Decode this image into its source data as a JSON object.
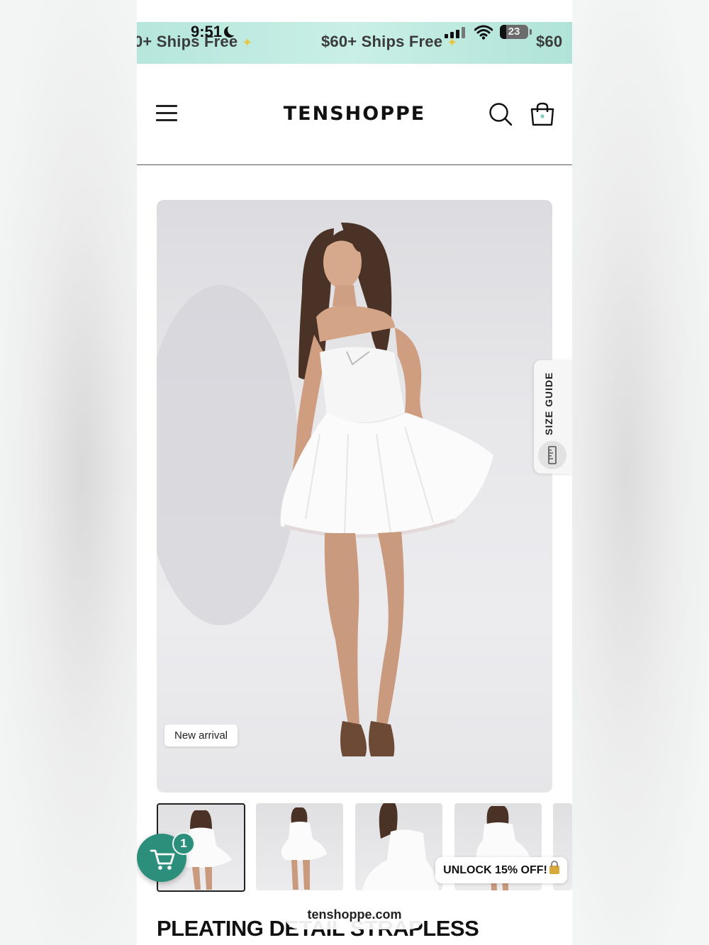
{
  "status_bar": {
    "time": "9:51",
    "battery": "23"
  },
  "promo_banner": {
    "text_left": "0+ Ships Free",
    "text_center": "$60+ Ships Free",
    "text_right": "$60"
  },
  "header": {
    "logo": "TENSHOPPE"
  },
  "product": {
    "badge": "New arrival",
    "size_guide_label": "SIZE GUIDE",
    "title": "PLEATING DETAIL STRAPLESS"
  },
  "cart": {
    "count": "1"
  },
  "promo_popup": {
    "label": "UNLOCK 15% OFF!"
  },
  "browser": {
    "url": "tenshoppe.com"
  },
  "colors": {
    "banner": "#b6e6dc",
    "cart_fab": "#2b8f7b",
    "background": "#ffffff"
  }
}
